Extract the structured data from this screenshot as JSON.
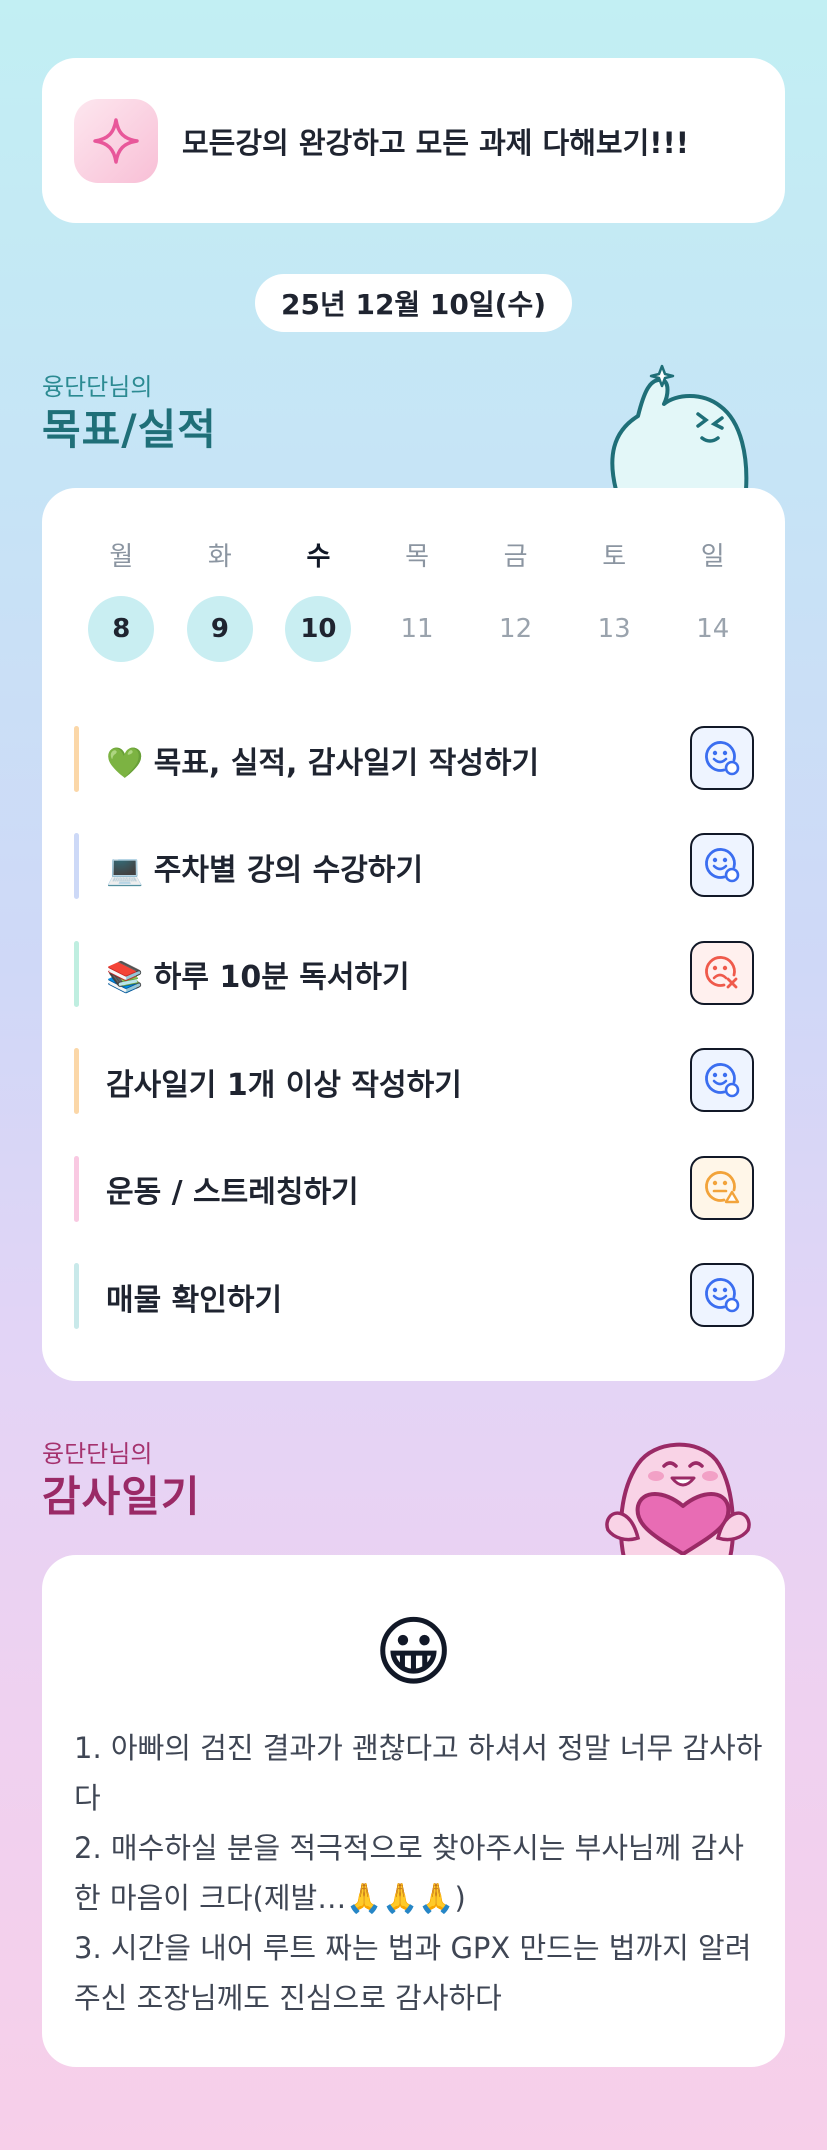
{
  "goal": {
    "text": "모든강의 완강하고 모든 과제 다해보기!!!",
    "icon": "sparkle-icon",
    "accent": "#e8579a"
  },
  "date": "25년 12월 10일(수)",
  "goals_section": {
    "owner": "융단단님의",
    "title": "목표/실적"
  },
  "calendar": {
    "weekdays": [
      "월",
      "화",
      "수",
      "목",
      "금",
      "토",
      "일"
    ],
    "days": [
      {
        "num": "8",
        "done": true
      },
      {
        "num": "9",
        "done": true
      },
      {
        "num": "10",
        "done": true
      },
      {
        "num": "11",
        "done": false
      },
      {
        "num": "12",
        "done": false
      },
      {
        "num": "13",
        "done": false
      },
      {
        "num": "14",
        "done": false
      }
    ],
    "today_index": 2
  },
  "tasks": [
    {
      "label": "💚 목표, 실적, 감사일기 작성하기",
      "bar_color": "#fbd7a8",
      "status": "good",
      "status_icon": "smile-check-icon"
    },
    {
      "label": "💻 주차별 강의 수강하기",
      "bar_color": "#cdd9f7",
      "status": "good",
      "status_icon": "smile-check-icon"
    },
    {
      "label": "📚 하루 10분 독서하기",
      "bar_color": "#bfeee0",
      "status": "bad",
      "status_icon": "frown-x-icon"
    },
    {
      "label": "감사일기 1개 이상 작성하기",
      "bar_color": "#fbd7a8",
      "status": "good",
      "status_icon": "smile-check-icon"
    },
    {
      "label": "운동 / 스트레칭하기",
      "bar_color": "#f9c9e2",
      "status": "mid",
      "status_icon": "neutral-warning-icon"
    },
    {
      "label": "매물 확인하기",
      "bar_color": "#c9e9ea",
      "status": "good",
      "status_icon": "smile-check-icon"
    }
  ],
  "status_colors": {
    "good": "#3b6ef0",
    "bad": "#ef5a4b",
    "mid": "#f2a33a"
  },
  "diary_section": {
    "owner": "융단단님의",
    "title": "감사일기"
  },
  "diary": {
    "emoji": "😀",
    "lines": [
      "1. 아빠의 검진 결과가 괜찮다고 하셔서 정말 너무 감사하다",
      "2. 매수하실 분을 적극적으로 찾아주시는 부사님께 감사한 마음이 크다(제발…🙏🙏🙏)",
      "3. 시간을 내어 루트 짜는 법과 GPX 만드는 법까지 알려주신 조장님께도 진심으로 감사하다"
    ]
  }
}
